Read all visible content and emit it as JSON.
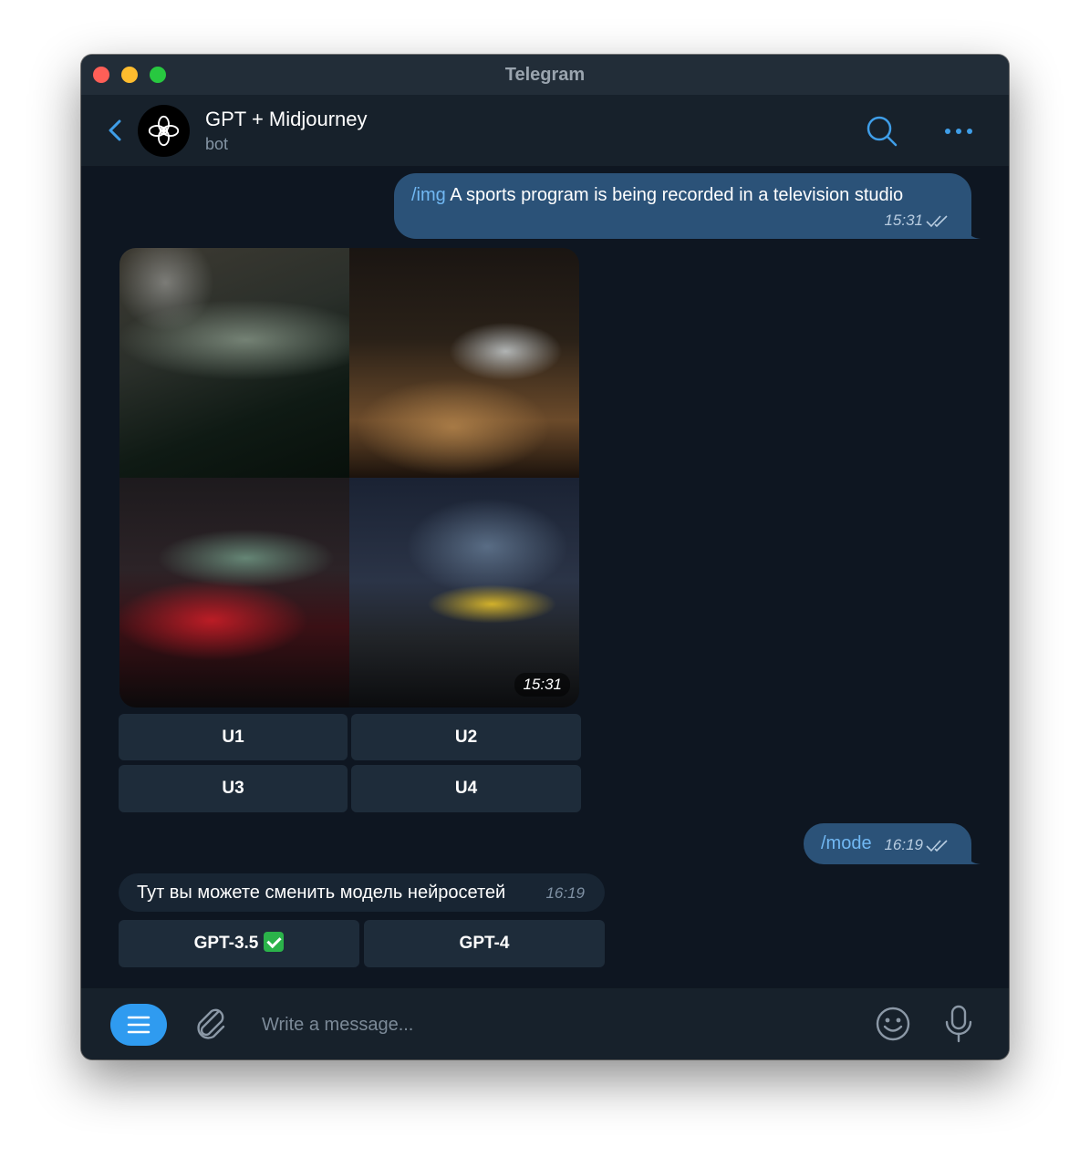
{
  "window": {
    "title": "Telegram"
  },
  "header": {
    "chat_name": "GPT + Midjourney",
    "status": "bot"
  },
  "messages": {
    "img_request": {
      "command": "/img",
      "text": " A sports program is being recorded in a television studio",
      "time": "15:31"
    },
    "image_result": {
      "time": "15:31",
      "buttons": [
        "U1",
        "U2",
        "U3",
        "U4"
      ]
    },
    "mode_request": {
      "command": "/mode",
      "time": "16:19"
    },
    "mode_reply": {
      "text": "Тут вы можете сменить модель нейросетей",
      "time": "16:19",
      "buttons": [
        "GPT-3.5",
        "GPT-4"
      ],
      "selected": "GPT-3.5"
    }
  },
  "composer": {
    "placeholder": "Write a message..."
  },
  "icons": [
    "back-icon",
    "avatar-logo-icon",
    "search-icon",
    "more-icon",
    "read-check-icon",
    "checkmark-emoji-icon",
    "menu-icon",
    "attach-icon",
    "emoji-icon",
    "mic-icon"
  ],
  "colors": {
    "background": "#17212b",
    "outgoing_bubble": "#2b5278",
    "incoming_bubble": "#182533",
    "accent": "#2f9bf0",
    "command": "#71b8f3"
  }
}
